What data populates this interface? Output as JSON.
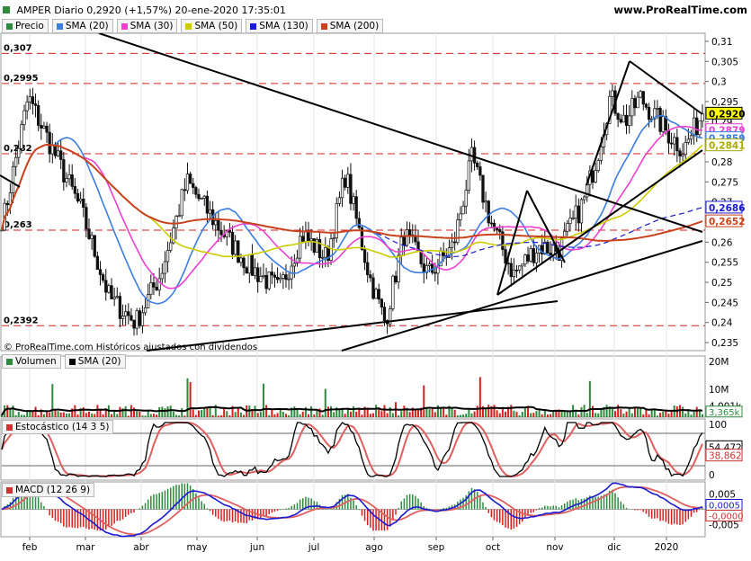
{
  "header": {
    "title": "AMPER Diario 0,2920 (+1,57%) 20-ene-2020 17:35:01",
    "site": "www.ProRealTime.com",
    "copyright": "© ProRealTime.com  Históricos ajustados con dividendos"
  },
  "price_legend": [
    {
      "label": "Precio",
      "color": "#2e8b3d"
    },
    {
      "label": "SMA (20)",
      "color": "#3b7de0"
    },
    {
      "label": "SMA (30)",
      "color": "#ee3fd2"
    },
    {
      "label": "SMA (50)",
      "color": "#cccc00"
    },
    {
      "label": "SMA (130)",
      "color": "#1a1ad0"
    },
    {
      "label": "SMA (200)",
      "color": "#c8421e"
    }
  ],
  "price_axis_ticks": [
    "0,31",
    "0,305",
    "0,3",
    "0,295",
    "0,29",
    "0,285",
    "0,28",
    "0,275",
    "0,27",
    "0,265",
    "0,26",
    "0,255",
    "0,25",
    "0,245",
    "0,24",
    "0,235"
  ],
  "left_levels": [
    "0,307",
    "0,2995",
    "0,282",
    "0,263",
    "0,2392"
  ],
  "price_badges": [
    {
      "value": "0,2920",
      "color": "#000000",
      "bg": "#ffff00"
    },
    {
      "value": "0,2879",
      "color": "#ee3fd2",
      "bg": "#ffffff"
    },
    {
      "value": "0,2859",
      "color": "#3b7de0",
      "bg": "#ffffff"
    },
    {
      "value": "0,2841",
      "color": "#aaaa00",
      "bg": "#ffffff"
    },
    {
      "value": "0,2686",
      "color": "#1a1ad0",
      "bg": "#ffffff"
    },
    {
      "value": "0,2652",
      "color": "#c8421e",
      "bg": "#ffffff"
    }
  ],
  "volume": {
    "legend": [
      {
        "label": "Volumen",
        "color": "#2e8b3d"
      },
      {
        "label": "SMA (20)",
        "color": "#000000"
      }
    ],
    "ticks": [
      "20M",
      "10M",
      "4,001k"
    ],
    "badge": "3,365k"
  },
  "stochastic": {
    "legend": [
      {
        "label": "Estocástico (14 3 5)",
        "color": "#cc3333"
      }
    ],
    "ticks": [
      "100",
      "0"
    ],
    "badges": [
      {
        "value": "54,472",
        "color": "#000000"
      },
      {
        "value": "38,862",
        "color": "#cc3333"
      }
    ]
  },
  "macd": {
    "legend": [
      {
        "label": "MACD (12 26 9)",
        "color": "#cc3333"
      }
    ],
    "ticks": [
      "0,005",
      "-0,005"
    ],
    "badges": [
      {
        "value": "0,0005",
        "color": "#1a1ad0"
      },
      {
        "value": "-0,0000",
        "color": "#cc3333"
      }
    ]
  },
  "x_axis_labels": [
    "feb",
    "mar",
    "abr",
    "may",
    "jun",
    "jul",
    "ago",
    "sep",
    "oct",
    "nov",
    "dic",
    "2020"
  ],
  "chart_data": {
    "type": "line",
    "title": "AMPER Diario 0,2920 (+1,57%) 20-ene-2020 17:35:01",
    "x_range": [
      "2019-01-14",
      "2020-01-20"
    ],
    "ylim": [
      0.233,
      0.312
    ],
    "grid": true,
    "horizontal_levels": [
      0.307,
      0.2995,
      0.282,
      0.263,
      0.2392
    ],
    "key_price_points": [
      {
        "date": "2019-01-15",
        "close": 0.266
      },
      {
        "date": "2019-01-28",
        "close": 0.296
      },
      {
        "date": "2019-02-10",
        "close": 0.283
      },
      {
        "date": "2019-02-25",
        "close": 0.268
      },
      {
        "date": "2019-03-12",
        "close": 0.246
      },
      {
        "date": "2019-03-26",
        "close": 0.24
      },
      {
        "date": "2019-04-08",
        "close": 0.252
      },
      {
        "date": "2019-04-22",
        "close": 0.275
      },
      {
        "date": "2019-05-10",
        "close": 0.263
      },
      {
        "date": "2019-05-25",
        "close": 0.254
      },
      {
        "date": "2019-06-10",
        "close": 0.248
      },
      {
        "date": "2019-06-22",
        "close": 0.262
      },
      {
        "date": "2019-07-05",
        "close": 0.256
      },
      {
        "date": "2019-07-15",
        "close": 0.277
      },
      {
        "date": "2019-07-28",
        "close": 0.251
      },
      {
        "date": "2019-08-05",
        "close": 0.24
      },
      {
        "date": "2019-08-15",
        "close": 0.262
      },
      {
        "date": "2019-08-28",
        "close": 0.252
      },
      {
        "date": "2019-09-10",
        "close": 0.259
      },
      {
        "date": "2019-09-20",
        "close": 0.281
      },
      {
        "date": "2019-09-30",
        "close": 0.265
      },
      {
        "date": "2019-10-12",
        "close": 0.252
      },
      {
        "date": "2019-10-25",
        "close": 0.259
      },
      {
        "date": "2019-11-05",
        "close": 0.258
      },
      {
        "date": "2019-11-18",
        "close": 0.27
      },
      {
        "date": "2019-11-25",
        "close": 0.281
      },
      {
        "date": "2019-12-02",
        "close": 0.296
      },
      {
        "date": "2019-12-10",
        "close": 0.29
      },
      {
        "date": "2019-12-18",
        "close": 0.296
      },
      {
        "date": "2020-01-02",
        "close": 0.287
      },
      {
        "date": "2020-01-10",
        "close": 0.283
      },
      {
        "date": "2020-01-20",
        "close": 0.292
      }
    ],
    "series": [
      {
        "name": "SMA (20)",
        "last": 0.2859
      },
      {
        "name": "SMA (30)",
        "last": 0.2879
      },
      {
        "name": "SMA (50)",
        "last": 0.2841
      },
      {
        "name": "SMA (130)",
        "last": 0.2686
      },
      {
        "name": "SMA (200)",
        "last": 0.2652
      }
    ],
    "volume_last": "3,365k",
    "stochastic_last": [
      54.472,
      38.862
    ],
    "macd_last": [
      0.0005,
      -0.0
    ]
  }
}
